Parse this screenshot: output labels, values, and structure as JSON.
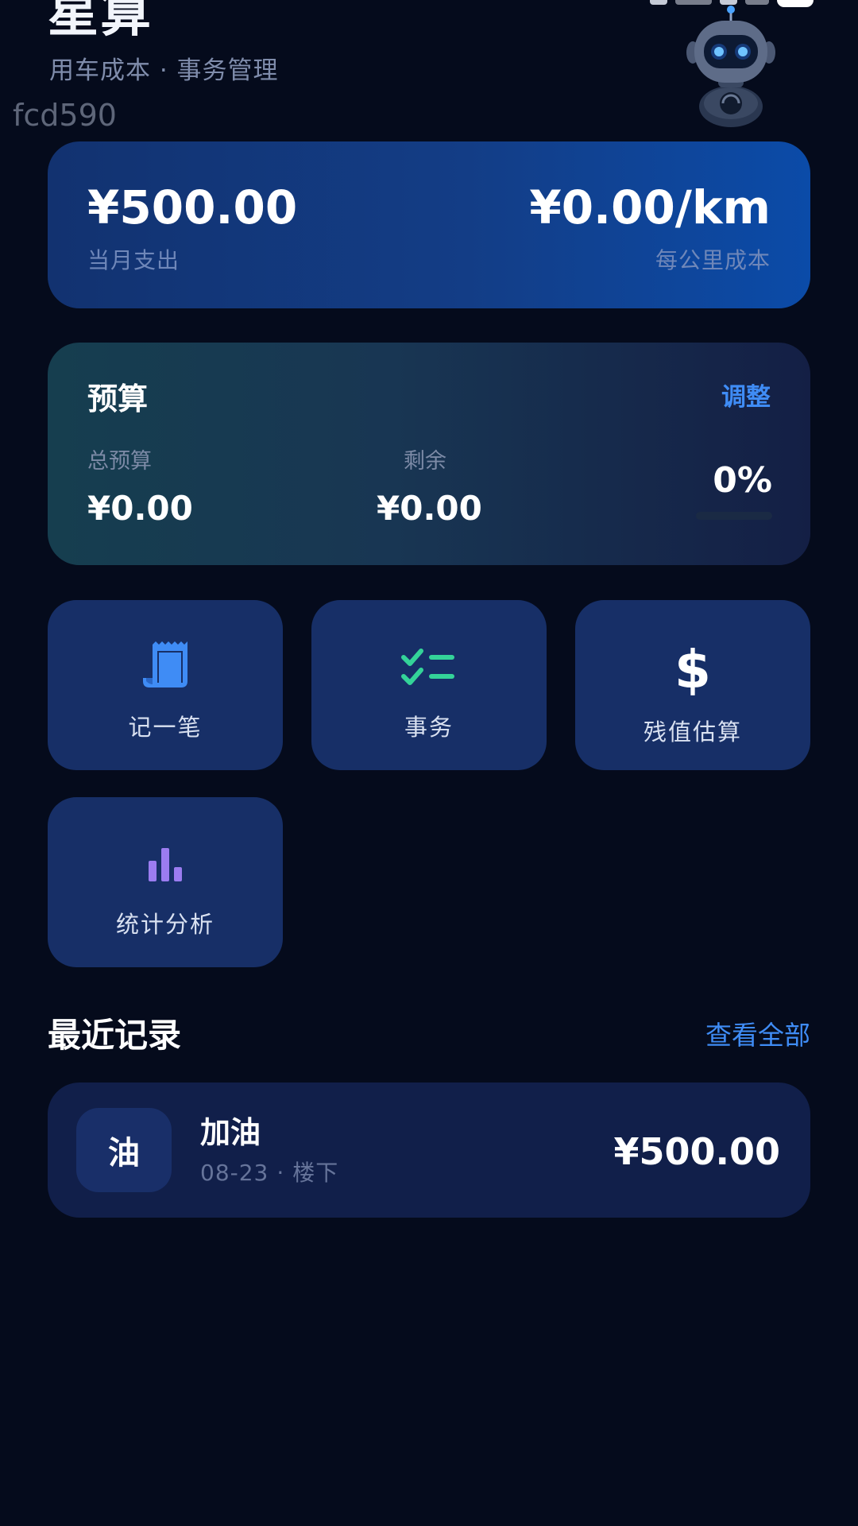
{
  "header": {
    "title": "星算",
    "subtitle": "用车成本 · 事务管理",
    "watermark": "fcd590"
  },
  "summary": {
    "monthly_spend": "¥500.00",
    "monthly_spend_label": "当月支出",
    "cost_per_km": "¥0.00/km",
    "cost_per_km_label": "每公里成本"
  },
  "budget": {
    "title": "预算",
    "adjust_label": "调整",
    "total_label": "总预算",
    "total_value": "¥0.00",
    "remaining_label": "剩余",
    "remaining_value": "¥0.00",
    "percent": "0%",
    "progress_fraction": 0
  },
  "actions": [
    {
      "label": "记一笔",
      "icon": "receipt-icon",
      "color": "#3f8cf5"
    },
    {
      "label": "事务",
      "icon": "checklist-icon",
      "color": "#34d399"
    },
    {
      "label": "残值估算",
      "icon": "dollar-icon",
      "color": "#ffffff"
    },
    {
      "label": "统计分析",
      "icon": "bar-chart-icon",
      "color": "#9b7cf0"
    }
  ],
  "recent": {
    "title": "最近记录",
    "view_all_label": "查看全部",
    "items": [
      {
        "badge": "油",
        "name": "加油",
        "date": "08-23",
        "separator": "·",
        "location": "楼下",
        "amount": "¥500.00"
      }
    ]
  },
  "colors": {
    "background": "#050b1c",
    "accent": "#3f8cf5",
    "tile": "#172f67",
    "summary_card_end": "#0b4ba8",
    "budget_card_start": "#163e4f"
  }
}
